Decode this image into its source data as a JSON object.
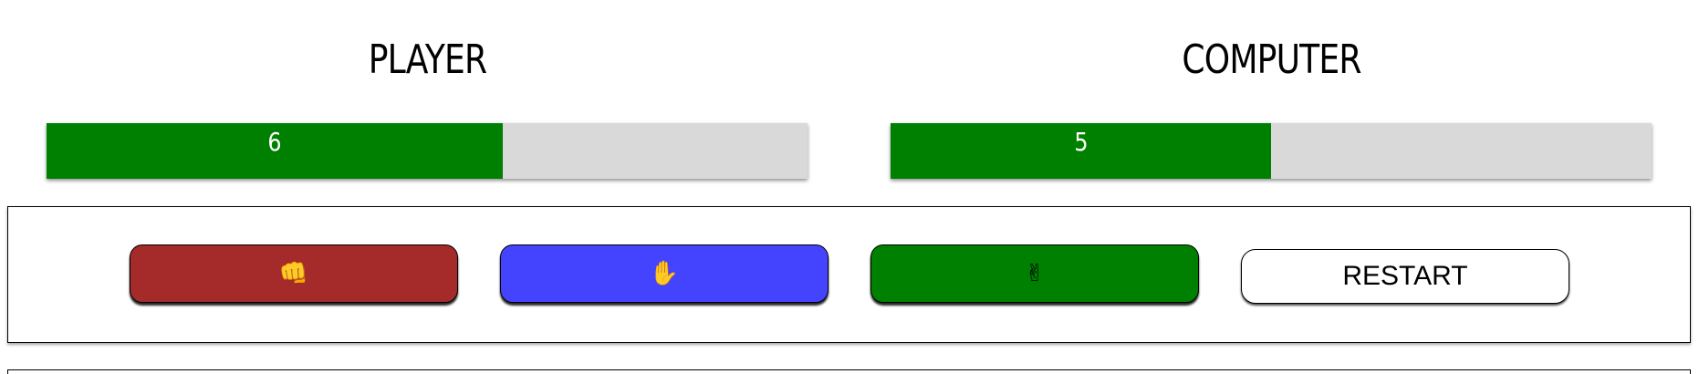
{
  "player": {
    "title": "PLAYER",
    "score": "6",
    "progress": 0.6,
    "bar_color": "#008000"
  },
  "computer": {
    "title": "COMPUTER",
    "score": "5",
    "progress": 0.5,
    "bar_color": "#008000"
  },
  "controls": {
    "rock": {
      "icon": "fist-icon",
      "glyph": "👊",
      "color": "#a52a2a"
    },
    "paper": {
      "icon": "raised-hand-icon",
      "glyph": "✋",
      "color": "#4444ff"
    },
    "scissors": {
      "icon": "victory-hand-icon",
      "glyph": "✌",
      "color": "#008000"
    },
    "restart_label": "RESTART"
  }
}
